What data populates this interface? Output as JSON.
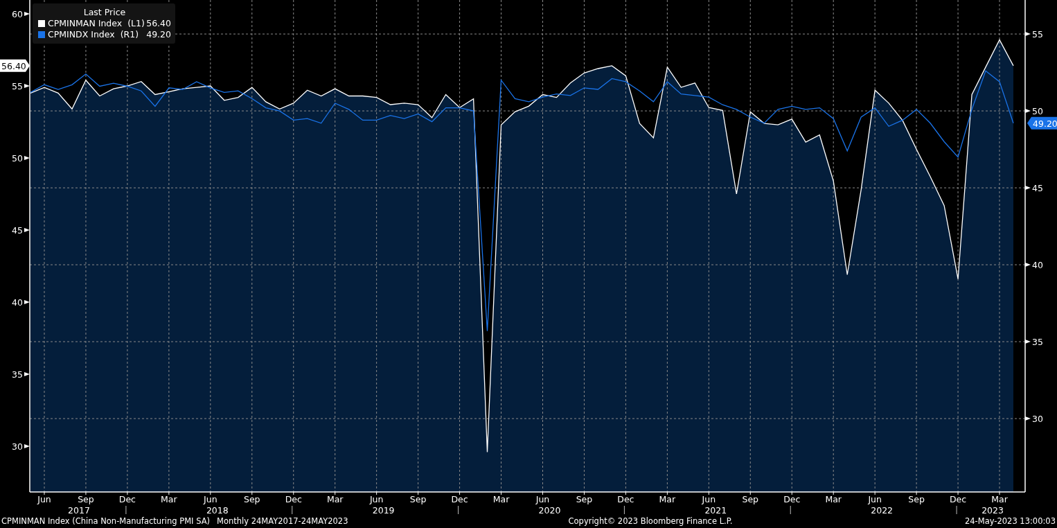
{
  "chart": {
    "legend": {
      "title": "Last Price",
      "entries": [
        {
          "axis": "(L1)",
          "value": "56.40"
        },
        {
          "axis": "(R1)",
          "value": "49.20"
        }
      ]
    },
    "last_value_tags": [
      "56.40",
      "49.20"
    ],
    "year_labels": [
      "2017",
      "2018",
      "2019",
      "2020",
      "2021",
      "2022",
      "2023"
    ],
    "chart_data": {
      "type": "line",
      "grid": true,
      "legend": "upper left",
      "categories": [
        null,
        "Jun",
        null,
        null,
        "Sep",
        null,
        null,
        "Dec",
        null,
        null,
        "Mar",
        null,
        null,
        "Jun",
        null,
        null,
        "Sep",
        null,
        null,
        "Dec",
        null,
        null,
        "Mar",
        null,
        null,
        "Jun",
        null,
        null,
        "Sep",
        null,
        null,
        "Dec",
        null,
        null,
        "Mar",
        null,
        null,
        "Jun",
        null,
        null,
        "Sep",
        null,
        null,
        "Dec",
        null,
        null,
        "Mar",
        null,
        null,
        "Jun",
        null,
        null,
        "Sep",
        null,
        null,
        "Dec",
        null,
        null,
        "Mar",
        null,
        null,
        "Jun",
        null,
        null,
        "Sep",
        null,
        null,
        "Dec",
        null,
        null,
        "Mar",
        null
      ],
      "ylim": [
        26.83,
        60.96
      ],
      "y2lim": [
        25.23,
        57.21
      ],
      "yticks": [
        30,
        35,
        40,
        45,
        50,
        55,
        60
      ],
      "y2ticks": [
        30,
        35,
        40,
        45,
        50,
        55
      ],
      "series": [
        {
          "name": "CPMINMAN Index",
          "axis": "y",
          "color": "#ffffff",
          "values": [
            54.5,
            54.9,
            54.5,
            53.4,
            55.4,
            54.3,
            54.8,
            55.0,
            55.3,
            54.4,
            54.6,
            54.8,
            54.9,
            55.0,
            54.0,
            54.2,
            54.9,
            53.9,
            53.4,
            53.8,
            54.7,
            54.3,
            54.8,
            54.3,
            54.3,
            54.2,
            53.7,
            53.8,
            53.7,
            52.8,
            54.4,
            53.5,
            54.1,
            29.6,
            52.3,
            53.2,
            53.6,
            54.4,
            54.2,
            55.2,
            55.9,
            56.2,
            56.4,
            55.7,
            52.4,
            51.4,
            56.3,
            54.9,
            55.2,
            53.5,
            53.3,
            47.5,
            53.2,
            52.4,
            52.3,
            52.7,
            51.1,
            51.6,
            48.4,
            41.9,
            47.8,
            54.7,
            53.8,
            52.6,
            50.6,
            48.7,
            46.7,
            41.6,
            54.4,
            56.3,
            58.2,
            56.4
          ]
        },
        {
          "name": "CPMINDX Index",
          "axis": "y2",
          "color": "#1a73e8",
          "values": [
            51.2,
            51.7,
            51.4,
            51.7,
            52.4,
            51.6,
            51.8,
            51.6,
            51.3,
            50.3,
            51.5,
            51.4,
            51.9,
            51.5,
            51.2,
            51.3,
            50.8,
            50.2,
            50.0,
            49.4,
            49.5,
            49.2,
            50.5,
            50.1,
            49.4,
            49.4,
            49.7,
            49.5,
            49.8,
            49.3,
            50.2,
            50.2,
            50.0,
            35.7,
            52.0,
            50.8,
            50.6,
            50.9,
            51.1,
            51.0,
            51.5,
            51.4,
            52.1,
            51.9,
            51.3,
            50.6,
            51.9,
            51.1,
            51.0,
            50.9,
            50.4,
            50.1,
            49.6,
            49.2,
            50.1,
            50.3,
            50.1,
            50.2,
            49.5,
            47.4,
            49.6,
            50.2,
            49.0,
            49.4,
            50.1,
            49.2,
            48.0,
            47.0,
            50.1,
            52.6,
            51.9,
            49.2
          ]
        }
      ]
    }
  },
  "footer": {
    "description": "CPMINMAN Index (China Non-Manufacturing PMI SA)",
    "period": "Monthly 24MAY2017-24MAY2023",
    "copyright": "Copyright© 2023 Bloomberg Finance L.P.",
    "timestamp": "24-May-2023 13:00:03"
  }
}
